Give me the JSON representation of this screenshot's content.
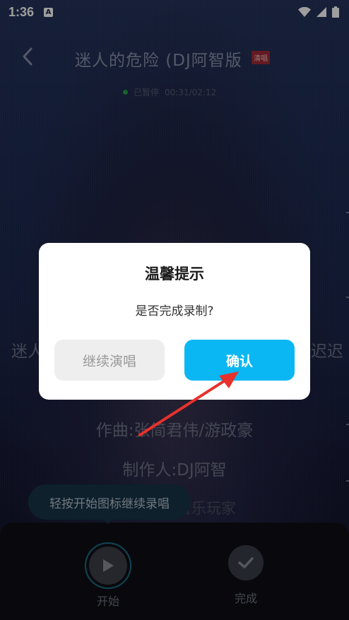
{
  "status_bar": {
    "time": "1:36",
    "notif_glyph": "A"
  },
  "header": {
    "title": "迷人的危险 (DJ阿智版",
    "badge": "清唱"
  },
  "playback": {
    "state": "已暂停",
    "time": "00:31/02:12"
  },
  "lyrics": {
    "left_fragment": "迷人",
    "right_fragment": "迟迟",
    "composer": "作曲:张简君伟/游政豪",
    "producer": "制作人:DJ阿智",
    "partial": "音乐玩家"
  },
  "hint": {
    "text": "轻按开始图标继续录唱"
  },
  "controls": {
    "start_label": "开始",
    "done_label": "完成"
  },
  "dialog": {
    "title": "温馨提示",
    "message": "是否完成录制?",
    "continue_label": "继续演唱",
    "confirm_label": "确认"
  },
  "colors": {
    "confirm": "#0bb7f2",
    "arrow": "#e8312c",
    "badge": "#a22a35"
  }
}
